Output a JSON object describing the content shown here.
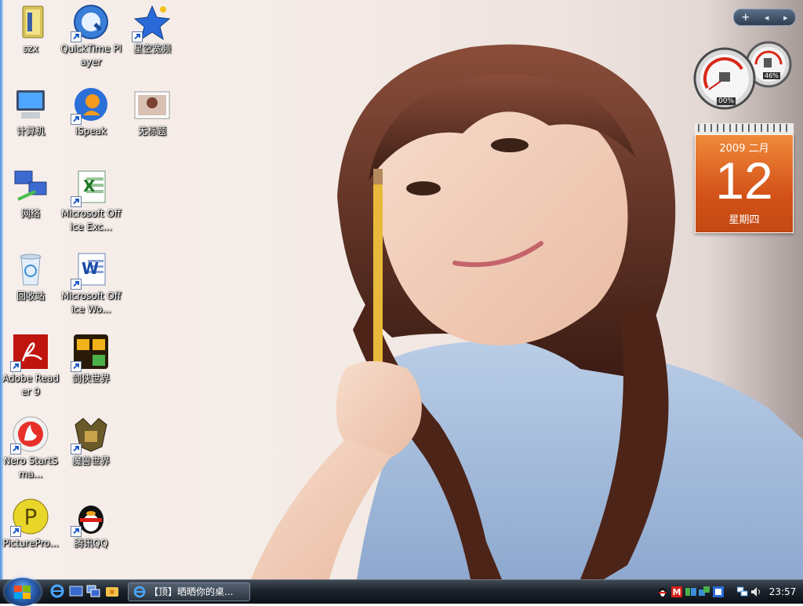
{
  "desktop": {
    "icons": [
      {
        "label": "szx"
      },
      {
        "label": "QuickTime Player"
      },
      {
        "label": "星空宽频"
      },
      {
        "label": "计算机"
      },
      {
        "label": "iSpeak"
      },
      {
        "label": "无标题"
      },
      {
        "label": "网络"
      },
      {
        "label": "Microsoft Office Exc..."
      },
      {
        "label": "回收站"
      },
      {
        "label": "Microsoft Office Wo..."
      },
      {
        "label": "Adobe Reader 9"
      },
      {
        "label": "剑侠世界"
      },
      {
        "label": "Nero StartSma..."
      },
      {
        "label": "魔兽世界"
      },
      {
        "label": "PicturePro..."
      },
      {
        "label": "腾讯QQ"
      }
    ]
  },
  "sidebar": {
    "controls": {
      "add": "+",
      "prev": "◂",
      "next": "▸"
    },
    "cpu_meter": {
      "cpu_percent": "00%",
      "memory_percent": "46%"
    },
    "calendar": {
      "year_month": "2009 二月",
      "day": "12",
      "weekday": "星期四"
    }
  },
  "taskbar": {
    "window_title": "【顶】晒晒你的桌...",
    "clock": "23:57"
  },
  "colors": {
    "calendar_accent": "#d4531a",
    "taskbar": "#1c232c"
  }
}
